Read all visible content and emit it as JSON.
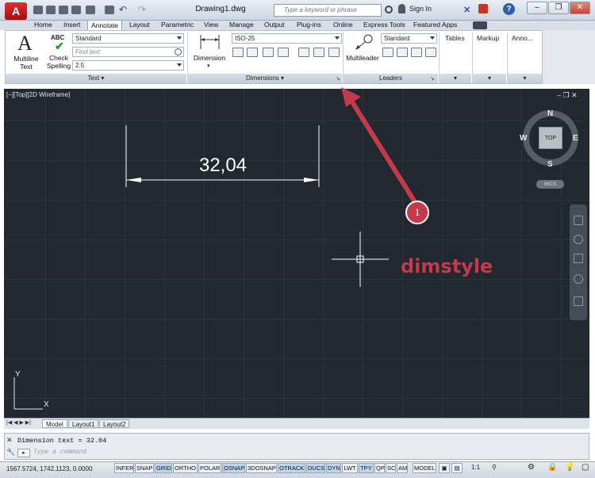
{
  "app": {
    "logo_letter": "A",
    "document_title": "Drawing1.dwg",
    "search_placeholder": "Type a keyword or phrase",
    "sign_in": "Sign In"
  },
  "tabs": [
    "Home",
    "Insert",
    "Annotate",
    "Layout",
    "Parametric",
    "View",
    "Manage",
    "Output",
    "Plug-ins",
    "Online",
    "Express Tools",
    "Featured Apps"
  ],
  "active_tab": "Annotate",
  "ribbon": {
    "text_panel": {
      "title": "Text",
      "multiline_label_1": "Multiline",
      "multiline_label_2": "Text",
      "check_label_1": "Check",
      "check_label_2": "Spelling",
      "abc": "ABC",
      "style_value": "Standard",
      "find_placeholder": "Find text",
      "height_value": "2.5"
    },
    "dimensions_panel": {
      "title": "Dimensions",
      "dimension_label": "Dimension",
      "style_value": "ISO-25"
    },
    "leaders_panel": {
      "title": "Leaders",
      "multileader_label": "Multileader",
      "style_value": "Standard"
    },
    "tables_label": "Tables",
    "markup_label": "Markup",
    "annotation_label": "Anno..."
  },
  "viewport": {
    "label": "[−][Top][2D Wireframe]",
    "dimension_text": "32,04",
    "annotation_text": "dimstyle",
    "callout_number": "1",
    "viewcube": {
      "top": "TOP",
      "north": "N",
      "south": "S",
      "east": "E",
      "west": "W",
      "wcs": "WCS"
    },
    "ucs_x": "X",
    "ucs_y": "Y"
  },
  "layout_tabs": [
    "Model",
    "Layout1",
    "Layout2"
  ],
  "command_line": {
    "history": "Dimension text = 32.04",
    "prompt": "Type a command"
  },
  "status": {
    "coordinates": "1567.5724, 1742.1123, 0.0000",
    "toggles": [
      {
        "label": "INFER",
        "on": false
      },
      {
        "label": "SNAP",
        "on": false
      },
      {
        "label": "GRID",
        "on": true
      },
      {
        "label": "ORTHO",
        "on": false
      },
      {
        "label": "POLAR",
        "on": false
      },
      {
        "label": "OSNAP",
        "on": true
      },
      {
        "label": "3DOSNAP",
        "on": false
      },
      {
        "label": "OTRACK",
        "on": true
      },
      {
        "label": "DUCS",
        "on": true
      },
      {
        "label": "DYN",
        "on": true
      },
      {
        "label": "LWT",
        "on": false
      },
      {
        "label": "TPY",
        "on": true
      },
      {
        "label": "QP",
        "on": false
      },
      {
        "label": "SC",
        "on": false
      },
      {
        "label": "AM",
        "on": false
      }
    ],
    "model_label": "MODEL",
    "scale": "1:1"
  },
  "colors": {
    "canvas": "#212830",
    "annotation": "#c43a4a",
    "dimension": "#ffffff"
  }
}
